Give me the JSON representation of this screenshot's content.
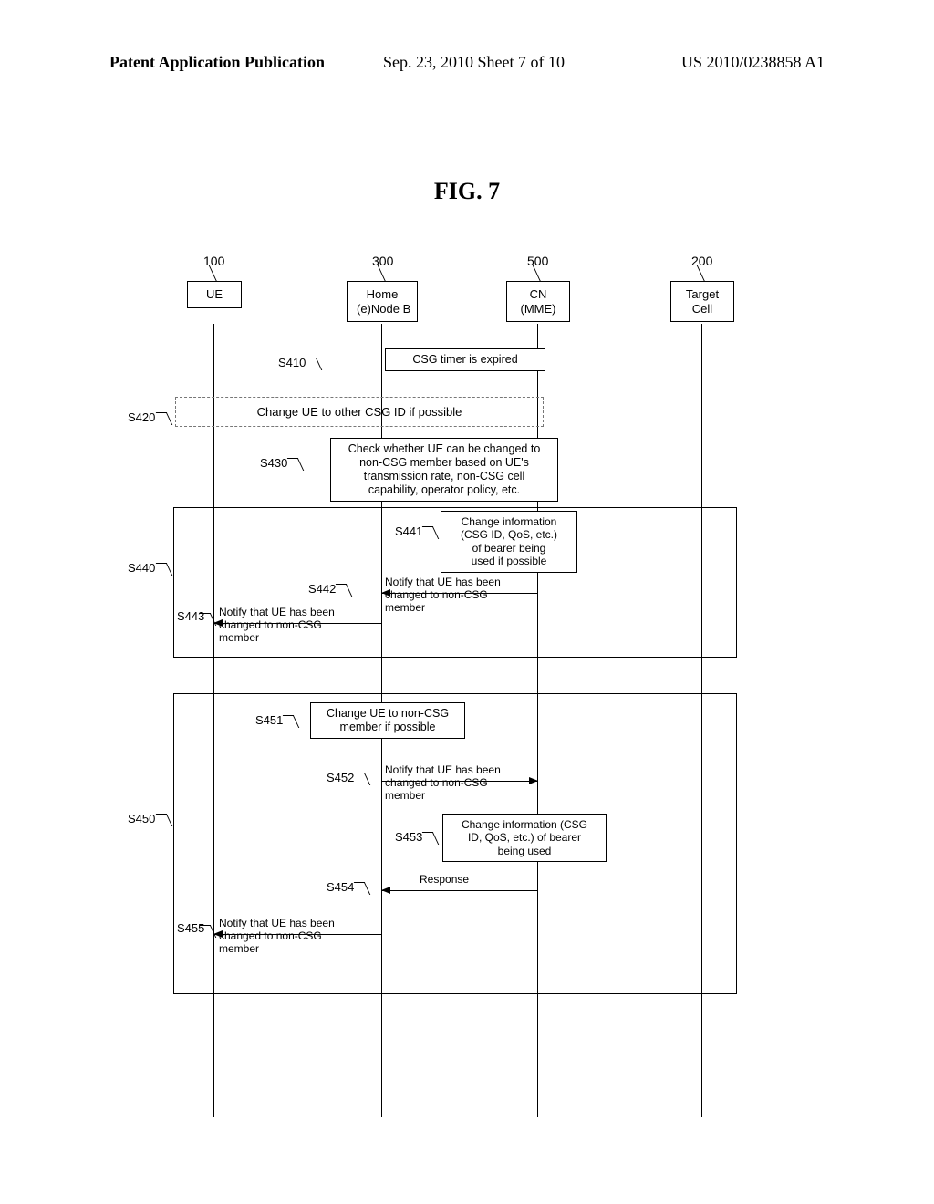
{
  "header": {
    "left": "Patent Application Publication",
    "center": "Sep. 23, 2010  Sheet 7 of 10",
    "right": "US 2010/0238858 A1"
  },
  "figure_title": "FIG. 7",
  "actors": {
    "ue": {
      "num": "100",
      "label": "UE"
    },
    "hnb": {
      "num": "300",
      "label": "Home\n(e)Node B"
    },
    "cn": {
      "num": "500",
      "label": "CN\n(MME)"
    },
    "target": {
      "num": "200",
      "label": "Target\nCell"
    }
  },
  "steps": {
    "s410": {
      "label": "S410",
      "text": "CSG timer is expired"
    },
    "s420": {
      "label": "S420",
      "text": "Change UE to other CSG ID if possible"
    },
    "s430": {
      "label": "S430",
      "text": "Check whether UE can be changed to\nnon-CSG member based on UE's\ntransmission rate, non-CSG cell\ncapability, operator policy, etc."
    },
    "s440": {
      "label": "S440"
    },
    "s441": {
      "label": "S441",
      "text": "Change information\n(CSG ID, QoS, etc.)\nof bearer being\nused if possible"
    },
    "s442": {
      "label": "S442",
      "text": "Notify that UE has been\nchanged to non-CSG\nmember"
    },
    "s443": {
      "label": "S443",
      "text": "Notify that UE has been\nchanged to non-CSG\nmember"
    },
    "s450": {
      "label": "S450"
    },
    "s451": {
      "label": "S451",
      "text": "Change UE to non-CSG\nmember if possible"
    },
    "s452": {
      "label": "S452",
      "text": "Notify that UE has been\nchanged to non-CSG\nmember"
    },
    "s453": {
      "label": "S453",
      "text": "Change information (CSG\nID, QoS, etc.) of bearer\nbeing used"
    },
    "s454": {
      "label": "S454",
      "text": "Response"
    },
    "s455": {
      "label": "S455",
      "text": "Notify that UE has been\nchanged to non-CSG\nmember"
    }
  }
}
